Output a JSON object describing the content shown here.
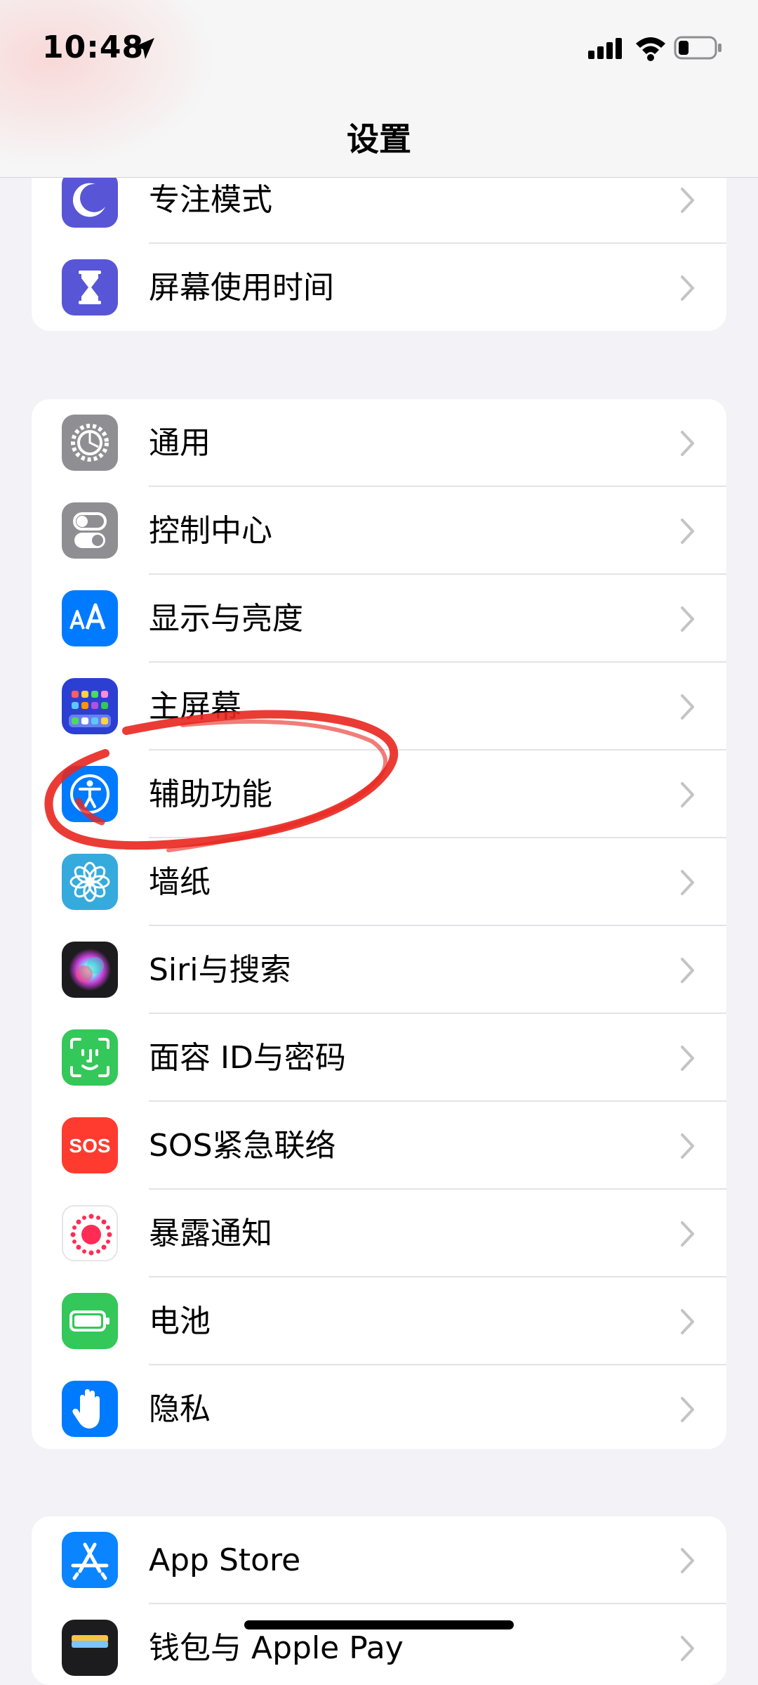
{
  "status_bar": {
    "time": "10:48"
  },
  "header": {
    "title": "设置"
  },
  "group1": [
    {
      "label": "专注模式",
      "icon": "moon-icon",
      "color": "#5856d6"
    },
    {
      "label": "屏幕使用时间",
      "icon": "hourglass-icon",
      "color": "#5856d6"
    }
  ],
  "group2": [
    {
      "label": "通用",
      "icon": "gear-icon",
      "color": "#8e8e93"
    },
    {
      "label": "控制中心",
      "icon": "toggles-icon",
      "color": "#8e8e93"
    },
    {
      "label": "显示与亮度",
      "icon": "text-size-icon",
      "color": "#007aff"
    },
    {
      "label": "主屏幕",
      "icon": "app-grid-icon",
      "color": "#2c3fd3"
    },
    {
      "label": "辅助功能",
      "icon": "accessibility-icon",
      "color": "#007aff"
    },
    {
      "label": "墙纸",
      "icon": "flower-icon",
      "color": "#35aadc"
    },
    {
      "label": "Siri与搜索",
      "icon": "siri-icon",
      "color": "#1c1c1e"
    },
    {
      "label": "面容 ID与密码",
      "icon": "face-id-icon",
      "color": "#34c759"
    },
    {
      "label": "SOS紧急联络",
      "icon": "sos-icon",
      "color": "#ff3b30",
      "badge": "SOS"
    },
    {
      "label": "暴露通知",
      "icon": "exposure-icon",
      "color": "#ffffff"
    },
    {
      "label": "电池",
      "icon": "battery-app-icon",
      "color": "#34c759"
    },
    {
      "label": "隐私",
      "icon": "hand-icon",
      "color": "#007aff"
    }
  ],
  "group3": [
    {
      "label": "App Store",
      "icon": "app-store-icon",
      "color": "#0a84ff"
    },
    {
      "label": "钱包与 Apple Pay",
      "icon": "wallet-icon",
      "color": "#1c1c1e"
    }
  ],
  "annotation_color": "#e8271f"
}
